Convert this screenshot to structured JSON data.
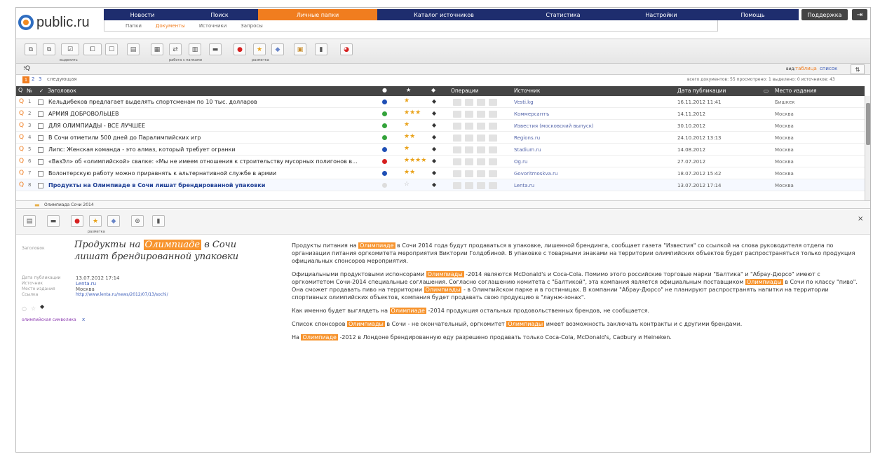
{
  "brand": "public.ru",
  "nav": [
    "Новости",
    "Поиск",
    "Личные папки",
    "Каталог источников",
    "Статистика",
    "Настройки",
    "Помощь"
  ],
  "support": "Поддержка",
  "subnav": [
    "Папки",
    "Документы",
    "Источники",
    "Запросы"
  ],
  "toolbar": {
    "group1": "выделить",
    "group2": "работа с папками",
    "group3": "разметка"
  },
  "view": {
    "label": "вид:",
    "table": "таблица",
    "list": "список"
  },
  "pager": {
    "pages": [
      "1",
      "2",
      "3"
    ],
    "next": "следующая",
    "stats": "всего документов: 55   просмотрено: 1   выделено: 0   источников: 43"
  },
  "headers": {
    "num": "№",
    "title": "Заголовок",
    "ops": "Операции",
    "source": "Источник",
    "date": "Дата публикации",
    "place": "Место издания"
  },
  "rows": [
    {
      "n": "1",
      "title": "Кельдибеков предлагает выделять спортсменам по 10 тыс. долларов",
      "src": "Vesti.kg",
      "date": "16.11.2012  11:41",
      "place": "Бишкек",
      "dot": "#1f4fb5",
      "stars": "★"
    },
    {
      "n": "2",
      "title": "АРМИЯ ДОБРОВОЛЬЦЕВ",
      "src": "Коммерсантъ",
      "date": "14.11.2012",
      "place": "Москва",
      "dot": "#33a33a",
      "stars": "★★★"
    },
    {
      "n": "3",
      "title": "ДЛЯ ОЛИМПИАДЫ - ВСЕ ЛУЧШЕЕ",
      "src": "Известия (московский выпуск)",
      "date": "30.10.2012",
      "place": "Москва",
      "dot": "#33a33a",
      "stars": "★"
    },
    {
      "n": "4",
      "title": "В Сочи отметили 500 дней до Паралимпийских игр",
      "src": "Regions.ru",
      "date": "24.10.2012  13:13",
      "place": "Москва",
      "dot": "#33a33a",
      "stars": "★★"
    },
    {
      "n": "5",
      "title": "Липс: Женская команда - это алмаз, который требует огранки",
      "src": "Stadium.ru",
      "date": "14.08.2012",
      "place": "Москва",
      "dot": "#1f4fb5",
      "stars": "★"
    },
    {
      "n": "6",
      "title": "«ВазЭл» об «олимпийской» свалке: «Мы не имеем отношения к строительству мусорных полигонов в...",
      "src": "Og.ru",
      "date": "27.07.2012",
      "place": "Москва",
      "dot": "#d62020",
      "stars": "★★★★"
    },
    {
      "n": "7",
      "title": "Волонтерскую работу можно приравнять к альтернативной службе в армии",
      "src": "Govoritmoskva.ru",
      "date": "18.07.2012  15:42",
      "place": "Москва",
      "dot": "#1f4fb5",
      "stars": "★★"
    },
    {
      "n": "8",
      "title": "Продукты на Олимпиаде в Сочи лишат брендированной упаковки",
      "src": "Lenta.ru",
      "date": "13.07.2012  17:14",
      "place": "Москва",
      "dot": "#dddddd",
      "stars": "☆"
    }
  ],
  "folder": "Олимпиада Сочи 2014",
  "detail": {
    "heading_label": "Заголовок",
    "title_a": "Продукты на",
    "title_hl": "Олимпиаде",
    "title_b": "в Сочи лишат брендированной упаковки",
    "meta_keys": [
      "Дата публикации",
      "Источник",
      "Место издания",
      "Ссылка"
    ],
    "meta_vals": [
      "13.07.2012 17:14",
      "Lenta.ru",
      "Москва",
      "http://www.lenta.ru/news/2012/07/13/sochi/"
    ],
    "tag": "олимпийская символика",
    "tag_close": "x",
    "hl": "Олимпиаде",
    "hl2": "Олимпиады",
    "p1a": "Продукты питания на",
    "p1b": "в Сочи 2014 года будут продаваться в упаковке, лишенной брендинга, сообщает газета \"Известия\" со ссылкой на слова руководителя отдела по организации питания оргкомитета мероприятия Виктории Голдобиной. В упаковке с товарными знаками на территории олимпийских объектов будет распространяться только продукция официальных спонсоров мероприятия.",
    "p2a": "Официальными продуктовыми испонсорами",
    "p2b": "-2014 являются McDonald's и Coca-Cola. Помимо этого российские торговые марки \"Балтика\" и \"Абрау-Дюрсо\" имеют с оргкомитетом Сочи-2014 специальные соглашения. Согласно соглашению комитета с \"Балтикой\", эта компания является официальным поставщиком",
    "p2c": "в Сочи по классу \"пиво\". Она сможет продавать пиво на территории",
    "p2d": "- в Олимпийском парке и в гостиницах. В компании \"Абрау-Дюрсо\" не планируют распространять напитки на территории спортивных олимпийских объектов, компания будет продавать свою продукцию в \"лаунж-зонах\".",
    "p3a": "Как именно будет выглядеть на",
    "p3b": "-2014 продукция остальных продовольственных брендов, не сообщается.",
    "p4a": "Список спонсоров",
    "p4b": "в Сочи - не окончательный, оргкомитет",
    "p4c": "имеет возможность заключать контракты и с другими брендами.",
    "p5a": "На",
    "p5b": "-2012 в Лондоне брендированную еду разрешено продавать только Coca-Cola, McDonald's, Cadbury и Heineken."
  }
}
